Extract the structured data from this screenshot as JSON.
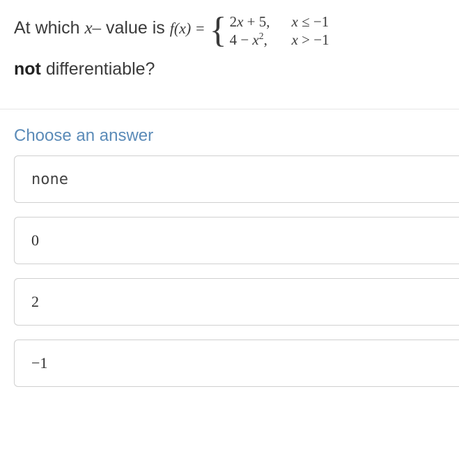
{
  "question": {
    "prefix": "At which ",
    "xvar": "x–",
    "middle": " value is ",
    "func_lhs": "f(x) = ",
    "piecewise": {
      "row1": {
        "expr": "2x + 5,",
        "cond": "x ≤ −1"
      },
      "row2": {
        "expr_pre": "4 − x",
        "expr_sup": "2",
        "expr_post": ",",
        "cond": "x > −1"
      }
    },
    "line2_bold": "not",
    "line2_rest": " differentiable?"
  },
  "choose_label": "Choose an answer",
  "answers": {
    "a": "none",
    "b": "0",
    "c": "2",
    "d": "−1"
  }
}
